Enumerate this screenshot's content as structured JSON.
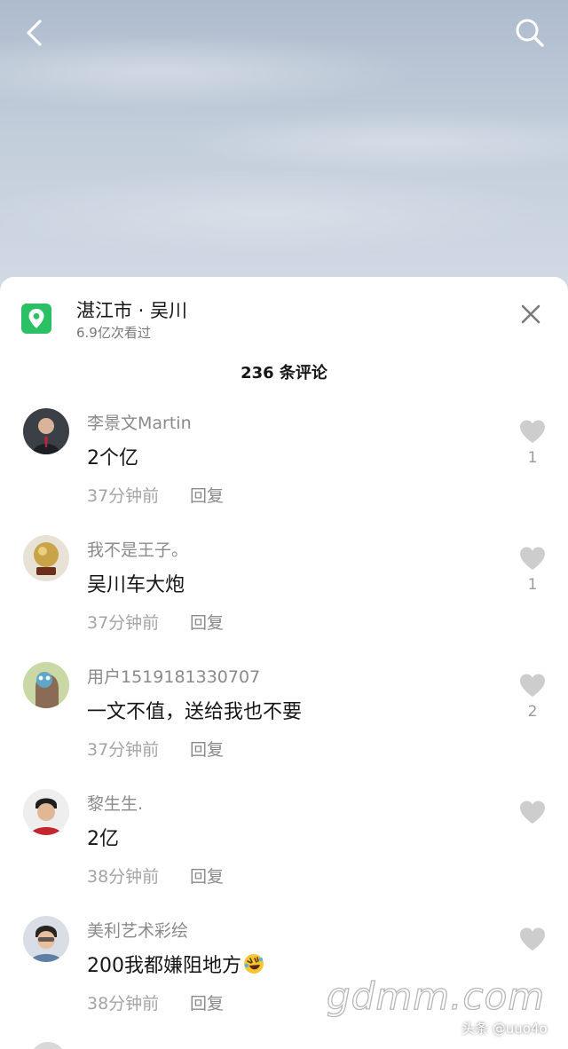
{
  "location": {
    "title": "湛江市 · 吴川",
    "views": "6.9亿次看过",
    "icon": "location-pin-icon",
    "icon_color": "#29c164"
  },
  "comments_header": "236 条评论",
  "reply_label": "回复",
  "comments": [
    {
      "user": "李景文Martin",
      "text": "2个亿",
      "time": "37分钟前",
      "likes": "1"
    },
    {
      "user": "我不是王子。",
      "text": "吴川车大炮",
      "time": "37分钟前",
      "likes": "1"
    },
    {
      "user": "用户1519181330707",
      "text": "一文不值，送给我也不要",
      "time": "37分钟前",
      "likes": "2"
    },
    {
      "user": "黎生生.",
      "text": "2亿",
      "time": "38分钟前",
      "likes": ""
    },
    {
      "user": "美利艺术彩绘",
      "text": "200我都嫌阻地方",
      "time": "38分钟前",
      "likes": ""
    }
  ],
  "watermark": "gdmm.com",
  "credit": "头条 @uuo4o",
  "colors": {
    "sheet_bg": "#ffffff",
    "like_gray": "#c8c8c8",
    "meta_gray": "#a4a4a4"
  }
}
